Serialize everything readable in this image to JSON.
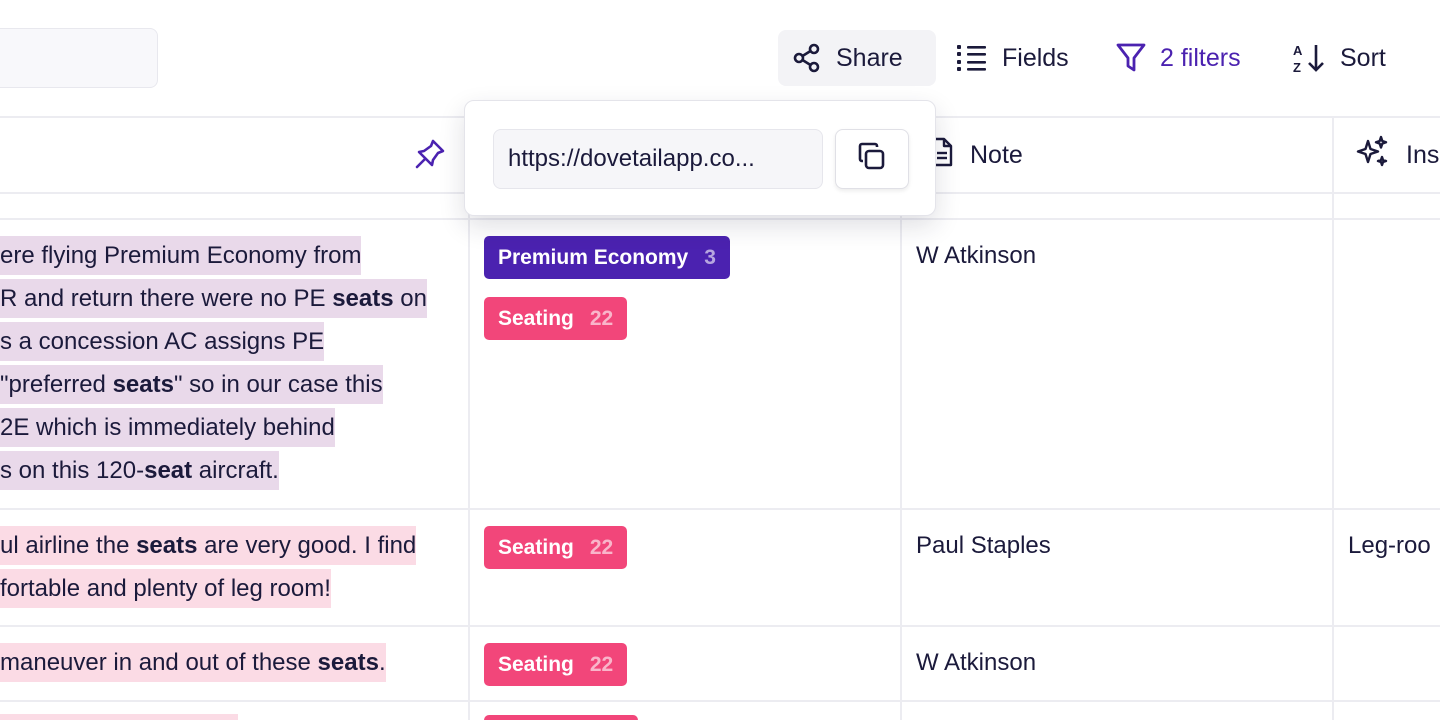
{
  "toolbar": {
    "share_label": "Share",
    "fields_label": "Fields",
    "filters_label": "2 filters",
    "sort_label": "Sort",
    "accent_color": "#4b22b0"
  },
  "share_popover": {
    "url": "https://dovetailapp.co..."
  },
  "columns": {
    "note": "Note",
    "insights": "Ins"
  },
  "rows": [
    {
      "quote_lines": [
        [
          {
            "t": "ere flying Premium Economy from"
          }
        ],
        [
          {
            "t": "R and return there were no PE "
          },
          {
            "t": "seats",
            "b": true
          },
          {
            "t": " on"
          }
        ],
        [
          {
            "t": "s a concession AC assigns PE"
          }
        ],
        [
          {
            "t": "\"preferred "
          },
          {
            "t": "seats",
            "b": true
          },
          {
            "t": "\" so in our case this"
          }
        ],
        [
          {
            "t": "2E which is immediately behind"
          }
        ],
        [
          {
            "t": "s on this 120-"
          },
          {
            "t": "seat",
            "b": true
          },
          {
            "t": " aircraft."
          }
        ]
      ],
      "tags": [
        {
          "label": "Premium Economy",
          "count": "3"
        },
        {
          "label": "Seating",
          "count": "22"
        }
      ],
      "note": "W Atkinson",
      "insight": ""
    },
    {
      "quote_lines": [
        [
          {
            "t": "ul airline the "
          },
          {
            "t": "seats",
            "b": true
          },
          {
            "t": " are very good. I find"
          }
        ],
        [
          {
            "t": "fortable and plenty of leg room!"
          }
        ]
      ],
      "tags": [
        {
          "label": "Seating",
          "count": "22"
        }
      ],
      "note": "Paul Staples",
      "insight": "Leg-roo"
    },
    {
      "quote_lines": [
        [
          {
            "t": "maneuver in and out of these "
          },
          {
            "t": "seats",
            "b": true
          },
          {
            "t": "."
          }
        ]
      ],
      "tags": [
        {
          "label": "Seating",
          "count": "22"
        }
      ],
      "note": "W Atkinson",
      "insight": ""
    }
  ]
}
